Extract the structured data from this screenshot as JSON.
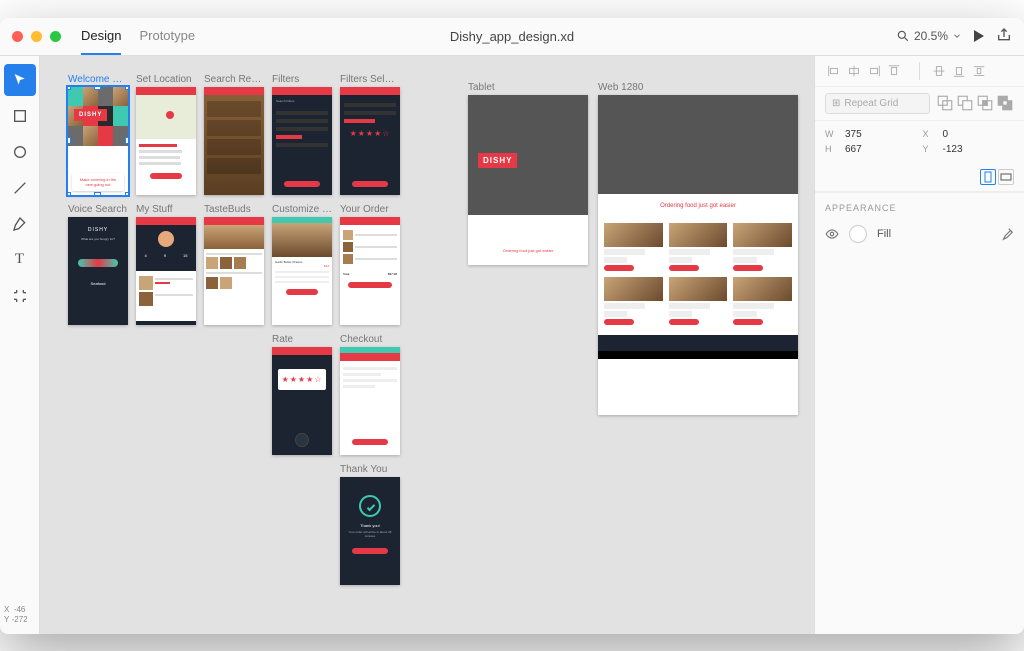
{
  "titlebar": {
    "tabs": {
      "design": "Design",
      "prototype": "Prototype"
    },
    "filename": "Dishy_app_design.xd",
    "zoom": "20.5%"
  },
  "toolbar_coords": {
    "x_label": "X",
    "x": "-46",
    "y_label": "Y",
    "y": "-272"
  },
  "artboards_row1": [
    {
      "label": "Welcome S…",
      "selected": true
    },
    {
      "label": "Set Location"
    },
    {
      "label": "Search Res…"
    },
    {
      "label": "Filters"
    },
    {
      "label": "Filters Selec…"
    }
  ],
  "artboards_row2": [
    {
      "label": "Voice Search"
    },
    {
      "label": "My Stuff"
    },
    {
      "label": "TasteBuds"
    },
    {
      "label": "Customize …"
    },
    {
      "label": "Your Order"
    }
  ],
  "artboards_row3": [
    {
      "label": "Rate"
    },
    {
      "label": "Checkout"
    }
  ],
  "artboards_row4": [
    {
      "label": "Thank You"
    }
  ],
  "large_artboards": [
    {
      "label": "Tablet"
    },
    {
      "label": "Web 1280"
    }
  ],
  "brand": "DISHY",
  "welcome_card": "Make ordering in the new going out",
  "tablet_hero": "Ordering food just got easier",
  "web_hero": "Ordering food just got easier",
  "voice": {
    "q": "What are you hungry for?",
    "answer": "Seafood"
  },
  "customize": {
    "dish": "Garlic Butter Prawns",
    "price": "$12"
  },
  "order": {
    "total_label": "Total",
    "total": "$97.98"
  },
  "thankyou": {
    "title": "Thank you!",
    "sub": "Your order will arrive in about 45 minutes",
    "btn": "Track Order"
  },
  "filters": {
    "title": "Search Filters"
  },
  "panel": {
    "repeat": "Repeat Grid",
    "w_label": "W",
    "w": "375",
    "x_label": "X",
    "x": "0",
    "h_label": "H",
    "h": "667",
    "y_label": "Y",
    "y": "-123",
    "appearance": "APPEARANCE",
    "fill": "Fill"
  }
}
